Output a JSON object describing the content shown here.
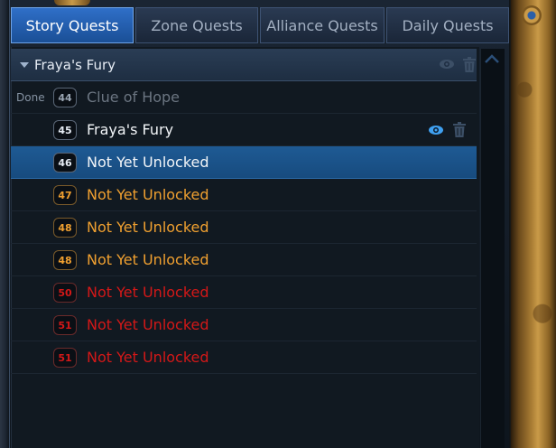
{
  "tabs": [
    {
      "label": "Story Quests",
      "active": true
    },
    {
      "label": "Zone Quests",
      "active": false
    },
    {
      "label": "Alliance Quests",
      "active": false
    },
    {
      "label": "Daily Quests",
      "active": false
    }
  ],
  "chapter": {
    "title": "Fraya's Fury",
    "icons": [
      "eye-icon",
      "trash-icon"
    ]
  },
  "quests": [
    {
      "status": "Done",
      "level": "44",
      "name": "Clue of Hope",
      "color": "#6b7581"
    },
    {
      "status": "",
      "level": "45",
      "name": "Fraya's Fury",
      "color": "#f2f5f8",
      "tracked": true
    },
    {
      "status": "",
      "level": "46",
      "name": "Not Yet Unlocked",
      "color": "#f2f5f8",
      "selected": true
    },
    {
      "status": "",
      "level": "47",
      "name": "Not Yet Unlocked",
      "color": "#f0a030"
    },
    {
      "status": "",
      "level": "48",
      "name": "Not Yet Unlocked",
      "color": "#f0a030"
    },
    {
      "status": "",
      "level": "48",
      "name": "Not Yet Unlocked",
      "color": "#f0a030"
    },
    {
      "status": "",
      "level": "50",
      "name": "Not Yet Unlocked",
      "color": "#d41818"
    },
    {
      "status": "",
      "level": "51",
      "name": "Not Yet Unlocked",
      "color": "#d41818"
    },
    {
      "status": "",
      "level": "51",
      "name": "Not Yet Unlocked",
      "color": "#d41818"
    }
  ],
  "colors": {
    "accent": "#2f6fc8",
    "selected_row": "#1e5a94",
    "eye_active": "#3fa0f0"
  }
}
